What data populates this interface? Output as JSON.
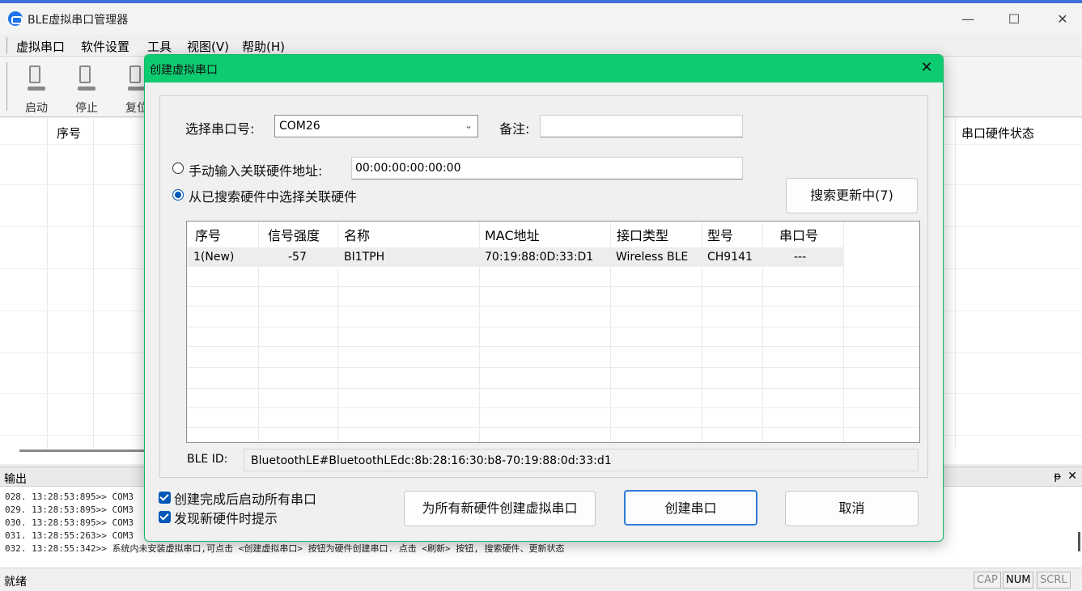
{
  "window": {
    "title": "BLE虚拟串口管理器",
    "minimize": "—",
    "maximize": "☐",
    "close": "✕"
  },
  "menu": [
    "虚拟串口",
    "软件设置",
    "工具",
    "视图(V)",
    "帮助(H)"
  ],
  "toolbar": {
    "start": "启动",
    "stop": "停止",
    "reset": "复位"
  },
  "main_grid": {
    "col_index": "序号",
    "col_hw_status": "串口硬件状态"
  },
  "output": {
    "title": "输出",
    "pin": "ᵽ",
    "close": "✕",
    "lines": [
      "028. 13:28:53:895>> COM3",
      "029. 13:28:53:895>> COM3",
      "030. 13:28:53:895>> COM3",
      "031. 13:28:55:263>> COM3",
      "032. 13:28:55:342>> 系统内未安装虚拟串口,可点击 <创建虚拟串口> 按钮为硬件创建串口. 点击 <刷新> 按钮, 搜索硬件、更新状态"
    ]
  },
  "statusbar": {
    "text": "就绪",
    "cap": "CAP",
    "num": "NUM",
    "scrl": "SCRL"
  },
  "dialog": {
    "title": "创建虚拟串口",
    "close": "✕",
    "port_label": "选择串口号:",
    "port_value": "COM26",
    "remark_label": "备注:",
    "remark_value": "",
    "manual_radio": "手动输入关联硬件地址:",
    "manual_value": "00:00:00:00:00:00",
    "select_radio": "从已搜索硬件中选择关联硬件",
    "search_button": "搜索更新中(7)",
    "table": {
      "headers": [
        "序号",
        "信号强度",
        "名称",
        "MAC地址",
        "接口类型",
        "型号",
        "串口号"
      ],
      "rows": [
        [
          "1(New)",
          "-57",
          "BI1TPH",
          "70:19:88:0D:33:D1",
          "Wireless BLE",
          "CH9141",
          "---"
        ]
      ]
    },
    "ble_id_label": "BLE ID:",
    "ble_id_value": "BluetoothLE#BluetoothLEdc:8b:28:16:30:b8-70:19:88:0d:33:d1",
    "check_start_all": "创建完成后启动所有串口",
    "check_notify": "发现新硬件时提示",
    "btn_create_all": "为所有新硬件创建虚拟串口",
    "btn_create": "创建串口",
    "btn_cancel": "取消",
    "accent_color": "#0dcb70"
  }
}
